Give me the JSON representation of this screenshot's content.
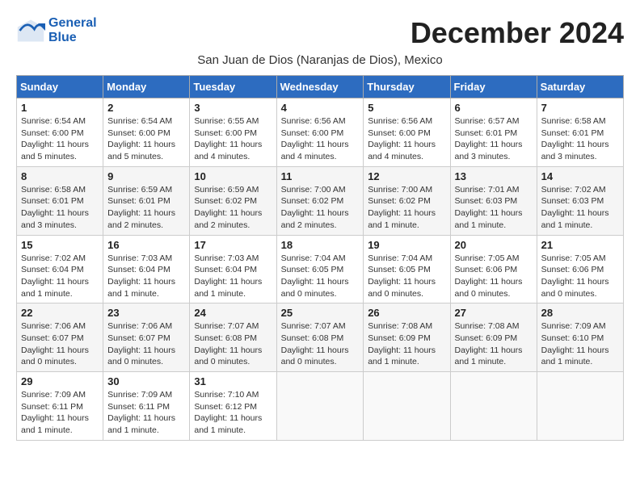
{
  "header": {
    "logo_general": "General",
    "logo_blue": "Blue",
    "month_title": "December 2024",
    "subtitle": "San Juan de Dios (Naranjas de Dios), Mexico"
  },
  "calendar": {
    "days_of_week": [
      "Sunday",
      "Monday",
      "Tuesday",
      "Wednesday",
      "Thursday",
      "Friday",
      "Saturday"
    ],
    "weeks": [
      [
        {
          "day": "1",
          "sunrise": "6:54 AM",
          "sunset": "6:00 PM",
          "daylight": "11 hours and 5 minutes."
        },
        {
          "day": "2",
          "sunrise": "6:54 AM",
          "sunset": "6:00 PM",
          "daylight": "11 hours and 5 minutes."
        },
        {
          "day": "3",
          "sunrise": "6:55 AM",
          "sunset": "6:00 PM",
          "daylight": "11 hours and 4 minutes."
        },
        {
          "day": "4",
          "sunrise": "6:56 AM",
          "sunset": "6:00 PM",
          "daylight": "11 hours and 4 minutes."
        },
        {
          "day": "5",
          "sunrise": "6:56 AM",
          "sunset": "6:00 PM",
          "daylight": "11 hours and 4 minutes."
        },
        {
          "day": "6",
          "sunrise": "6:57 AM",
          "sunset": "6:01 PM",
          "daylight": "11 hours and 3 minutes."
        },
        {
          "day": "7",
          "sunrise": "6:58 AM",
          "sunset": "6:01 PM",
          "daylight": "11 hours and 3 minutes."
        }
      ],
      [
        {
          "day": "8",
          "sunrise": "6:58 AM",
          "sunset": "6:01 PM",
          "daylight": "11 hours and 3 minutes."
        },
        {
          "day": "9",
          "sunrise": "6:59 AM",
          "sunset": "6:01 PM",
          "daylight": "11 hours and 2 minutes."
        },
        {
          "day": "10",
          "sunrise": "6:59 AM",
          "sunset": "6:02 PM",
          "daylight": "11 hours and 2 minutes."
        },
        {
          "day": "11",
          "sunrise": "7:00 AM",
          "sunset": "6:02 PM",
          "daylight": "11 hours and 2 minutes."
        },
        {
          "day": "12",
          "sunrise": "7:00 AM",
          "sunset": "6:02 PM",
          "daylight": "11 hours and 1 minute."
        },
        {
          "day": "13",
          "sunrise": "7:01 AM",
          "sunset": "6:03 PM",
          "daylight": "11 hours and 1 minute."
        },
        {
          "day": "14",
          "sunrise": "7:02 AM",
          "sunset": "6:03 PM",
          "daylight": "11 hours and 1 minute."
        }
      ],
      [
        {
          "day": "15",
          "sunrise": "7:02 AM",
          "sunset": "6:04 PM",
          "daylight": "11 hours and 1 minute."
        },
        {
          "day": "16",
          "sunrise": "7:03 AM",
          "sunset": "6:04 PM",
          "daylight": "11 hours and 1 minute."
        },
        {
          "day": "17",
          "sunrise": "7:03 AM",
          "sunset": "6:04 PM",
          "daylight": "11 hours and 1 minute."
        },
        {
          "day": "18",
          "sunrise": "7:04 AM",
          "sunset": "6:05 PM",
          "daylight": "11 hours and 0 minutes."
        },
        {
          "day": "19",
          "sunrise": "7:04 AM",
          "sunset": "6:05 PM",
          "daylight": "11 hours and 0 minutes."
        },
        {
          "day": "20",
          "sunrise": "7:05 AM",
          "sunset": "6:06 PM",
          "daylight": "11 hours and 0 minutes."
        },
        {
          "day": "21",
          "sunrise": "7:05 AM",
          "sunset": "6:06 PM",
          "daylight": "11 hours and 0 minutes."
        }
      ],
      [
        {
          "day": "22",
          "sunrise": "7:06 AM",
          "sunset": "6:07 PM",
          "daylight": "11 hours and 0 minutes."
        },
        {
          "day": "23",
          "sunrise": "7:06 AM",
          "sunset": "6:07 PM",
          "daylight": "11 hours and 0 minutes."
        },
        {
          "day": "24",
          "sunrise": "7:07 AM",
          "sunset": "6:08 PM",
          "daylight": "11 hours and 0 minutes."
        },
        {
          "day": "25",
          "sunrise": "7:07 AM",
          "sunset": "6:08 PM",
          "daylight": "11 hours and 0 minutes."
        },
        {
          "day": "26",
          "sunrise": "7:08 AM",
          "sunset": "6:09 PM",
          "daylight": "11 hours and 1 minute."
        },
        {
          "day": "27",
          "sunrise": "7:08 AM",
          "sunset": "6:09 PM",
          "daylight": "11 hours and 1 minute."
        },
        {
          "day": "28",
          "sunrise": "7:09 AM",
          "sunset": "6:10 PM",
          "daylight": "11 hours and 1 minute."
        }
      ],
      [
        {
          "day": "29",
          "sunrise": "7:09 AM",
          "sunset": "6:11 PM",
          "daylight": "11 hours and 1 minute."
        },
        {
          "day": "30",
          "sunrise": "7:09 AM",
          "sunset": "6:11 PM",
          "daylight": "11 hours and 1 minute."
        },
        {
          "day": "31",
          "sunrise": "7:10 AM",
          "sunset": "6:12 PM",
          "daylight": "11 hours and 1 minute."
        },
        null,
        null,
        null,
        null
      ]
    ],
    "sunrise_label": "Sunrise: ",
    "sunset_label": "Sunset: ",
    "daylight_label": "Daylight: "
  }
}
